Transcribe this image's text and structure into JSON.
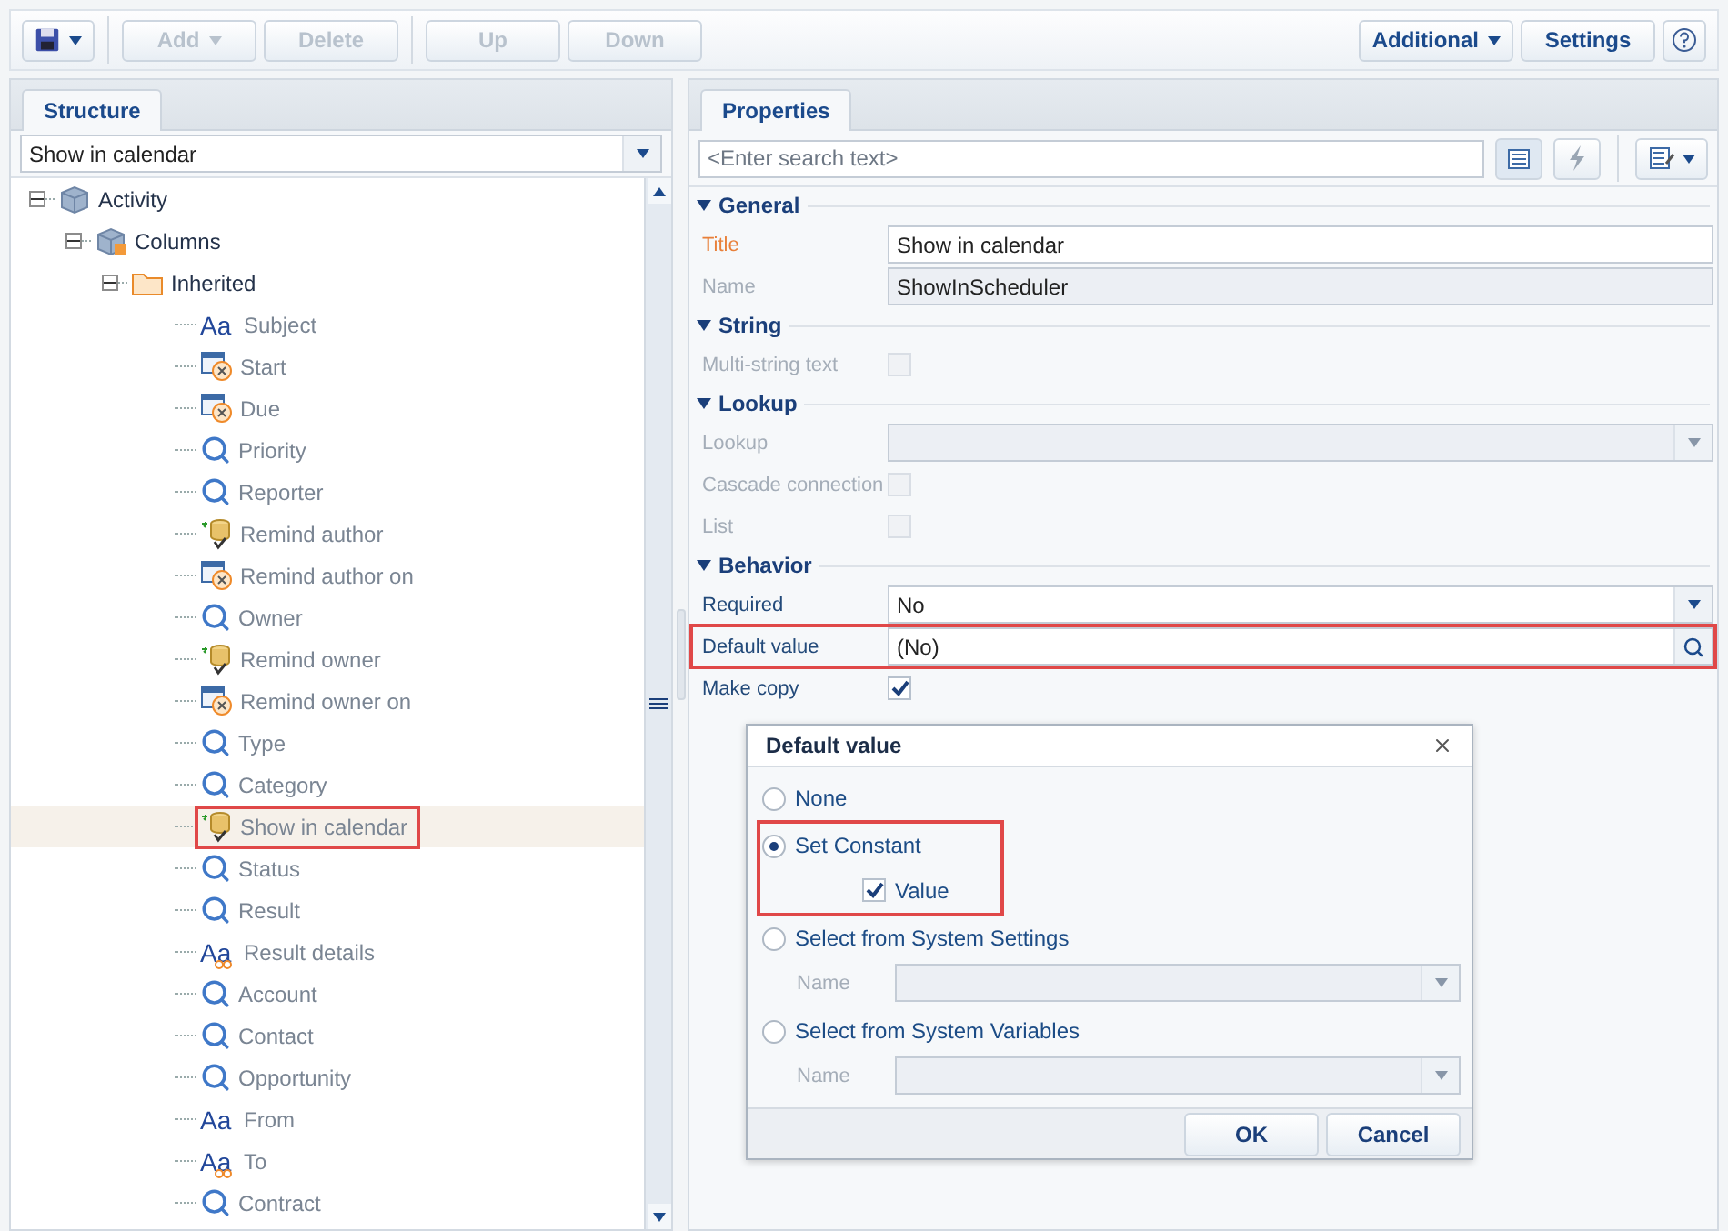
{
  "toolbar": {
    "left": [
      {
        "kind": "save",
        "dropdown": true,
        "disabled": false
      },
      {
        "kind": "text",
        "label": "Add",
        "dropdown": true,
        "disabled": true
      },
      {
        "kind": "text",
        "label": "Delete",
        "dropdown": false,
        "disabled": true
      },
      {
        "kind": "text",
        "label": "Up",
        "dropdown": false,
        "disabled": true
      },
      {
        "kind": "text",
        "label": "Down",
        "dropdown": false,
        "disabled": true
      }
    ],
    "right": [
      {
        "kind": "text",
        "label": "Additional",
        "dropdown": true,
        "disabled": false
      },
      {
        "kind": "text",
        "label": "Settings",
        "dropdown": false,
        "disabled": false
      },
      {
        "kind": "help",
        "dropdown": false,
        "disabled": false
      }
    ]
  },
  "structure": {
    "tab": "Structure",
    "selector": "Show in calendar",
    "tree": [
      {
        "label": "Activity",
        "kind": "object",
        "expanded": true,
        "selected": false,
        "children": [
          {
            "label": "Columns",
            "kind": "columns",
            "expanded": true,
            "selected": false,
            "children": [
              {
                "label": "Inherited",
                "kind": "folder",
                "expanded": true,
                "selected": false,
                "children": [
                  {
                    "label": "Subject",
                    "kind": "string",
                    "glyph": "Aa",
                    "selected": false
                  },
                  {
                    "label": "Start",
                    "kind": "datetime",
                    "selected": false
                  },
                  {
                    "label": "Due",
                    "kind": "datetime",
                    "selected": false
                  },
                  {
                    "label": "Priority",
                    "kind": "lookup",
                    "selected": false
                  },
                  {
                    "label": "Reporter",
                    "kind": "lookup",
                    "selected": false
                  },
                  {
                    "label": "Remind author",
                    "kind": "boolean",
                    "selected": false
                  },
                  {
                    "label": "Remind author on",
                    "kind": "datetime",
                    "selected": false
                  },
                  {
                    "label": "Owner",
                    "kind": "lookup",
                    "selected": false
                  },
                  {
                    "label": "Remind owner",
                    "kind": "boolean",
                    "selected": false
                  },
                  {
                    "label": "Remind owner on",
                    "kind": "datetime",
                    "selected": false
                  },
                  {
                    "label": "Type",
                    "kind": "lookup",
                    "selected": false
                  },
                  {
                    "label": "Category",
                    "kind": "lookup",
                    "selected": false
                  },
                  {
                    "label": "Show in calendar",
                    "kind": "boolean",
                    "selected": true
                  },
                  {
                    "label": "Status",
                    "kind": "lookup",
                    "selected": false
                  },
                  {
                    "label": "Result",
                    "kind": "lookup",
                    "selected": false
                  },
                  {
                    "label": "Result details",
                    "kind": "text",
                    "glyph": "Aa",
                    "selected": false
                  },
                  {
                    "label": "Account",
                    "kind": "lookup",
                    "selected": false
                  },
                  {
                    "label": "Contact",
                    "kind": "lookup",
                    "selected": false
                  },
                  {
                    "label": "Opportunity",
                    "kind": "lookup",
                    "selected": false
                  },
                  {
                    "label": "From",
                    "kind": "string",
                    "glyph": "Aa",
                    "selected": false
                  },
                  {
                    "label": "To",
                    "kind": "text",
                    "glyph": "Aa",
                    "selected": false
                  },
                  {
                    "label": "Contract",
                    "kind": "lookup",
                    "selected": false
                  }
                ]
              }
            ]
          }
        ]
      }
    ]
  },
  "properties": {
    "tab": "Properties",
    "search": {
      "placeholder": "<Enter search text>"
    },
    "sections": [
      {
        "title": "General",
        "expanded": true,
        "fields": [
          {
            "label": "Title",
            "kind": "text",
            "value": "Show in calendar",
            "required": true,
            "disabled": false,
            "highlighted": false
          },
          {
            "label": "Name",
            "kind": "text",
            "value": "ShowInScheduler",
            "required": false,
            "disabled": true,
            "highlighted": false
          }
        ]
      },
      {
        "title": "String",
        "expanded": true,
        "fields": [
          {
            "label": "Multi-string text",
            "kind": "checkbox",
            "checked": false,
            "required": false,
            "disabled": true,
            "highlighted": false
          }
        ]
      },
      {
        "title": "Lookup",
        "expanded": true,
        "fields": [
          {
            "label": "Lookup",
            "kind": "select",
            "required": false,
            "disabled": true,
            "highlighted": false
          },
          {
            "label": "Cascade connection",
            "kind": "checkbox",
            "checked": false,
            "required": false,
            "disabled": true,
            "highlighted": false
          },
          {
            "label": "List",
            "kind": "checkbox",
            "checked": false,
            "required": false,
            "disabled": true,
            "highlighted": false
          }
        ]
      },
      {
        "title": "Behavior",
        "expanded": true,
        "fields": [
          {
            "label": "Required",
            "kind": "select",
            "value": "No",
            "required": false,
            "disabled": false,
            "highlighted": false
          },
          {
            "label": "Default value",
            "kind": "lookup",
            "value": "(No)",
            "required": false,
            "disabled": false,
            "highlighted": true
          },
          {
            "label": "Make copy",
            "kind": "checkbox",
            "checked": true,
            "required": false,
            "disabled": false,
            "highlighted": false
          }
        ]
      }
    ]
  },
  "dialog": {
    "title": "Default value",
    "options": [
      {
        "label": "None",
        "selected": false,
        "highlighted": false
      },
      {
        "label": "Set Constant",
        "selected": true,
        "highlighted": true,
        "checkbox": {
          "label": "Value",
          "checked": true
        }
      },
      {
        "label": "Select from System Settings",
        "selected": false,
        "highlighted": false,
        "field": {
          "label": "Name"
        }
      },
      {
        "label": "Select from System Variables",
        "selected": false,
        "highlighted": false,
        "field": {
          "label": "Name"
        }
      }
    ],
    "buttons": [
      {
        "label": "OK"
      },
      {
        "label": "Cancel"
      }
    ]
  }
}
